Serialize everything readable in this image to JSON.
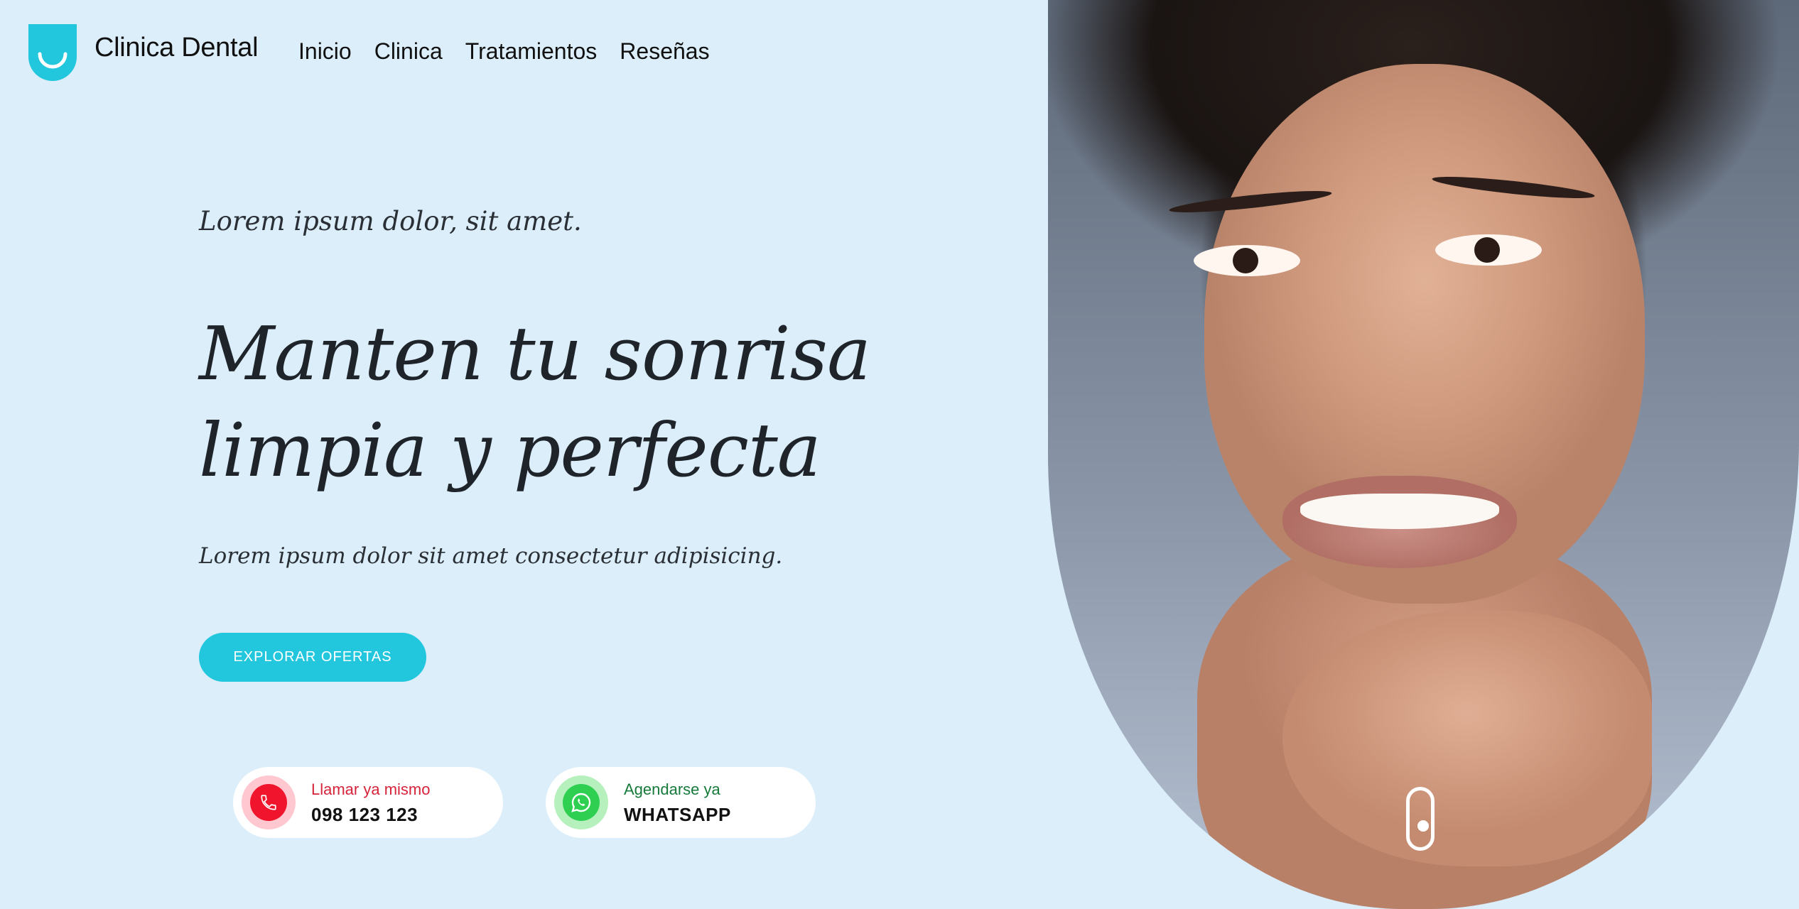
{
  "header": {
    "brand": "Clinica Dental",
    "nav": [
      "Inicio",
      "Clinica",
      "Tratamientos",
      "Reseñas"
    ]
  },
  "hero": {
    "eyebrow": "Lorem ipsum dolor, sit amet.",
    "headline_line1": "Manten tu sonrisa",
    "headline_line2": "limpia y perfecta",
    "subtitle": "Lorem ipsum dolor sit amet consectetur adipisicing.",
    "cta": "EXPLORAR OFERTAS"
  },
  "contact": {
    "call": {
      "label": "Llamar ya mismo",
      "value": "098 123 123",
      "icon": "phone-icon"
    },
    "whatsapp": {
      "label": "Agendarse ya",
      "value": "WHATSAPP",
      "icon": "whatsapp-icon"
    }
  },
  "colors": {
    "background": "#dbeefa",
    "accent": "#22c7de",
    "call": "#f0152d",
    "whatsapp": "#2fcf52"
  }
}
